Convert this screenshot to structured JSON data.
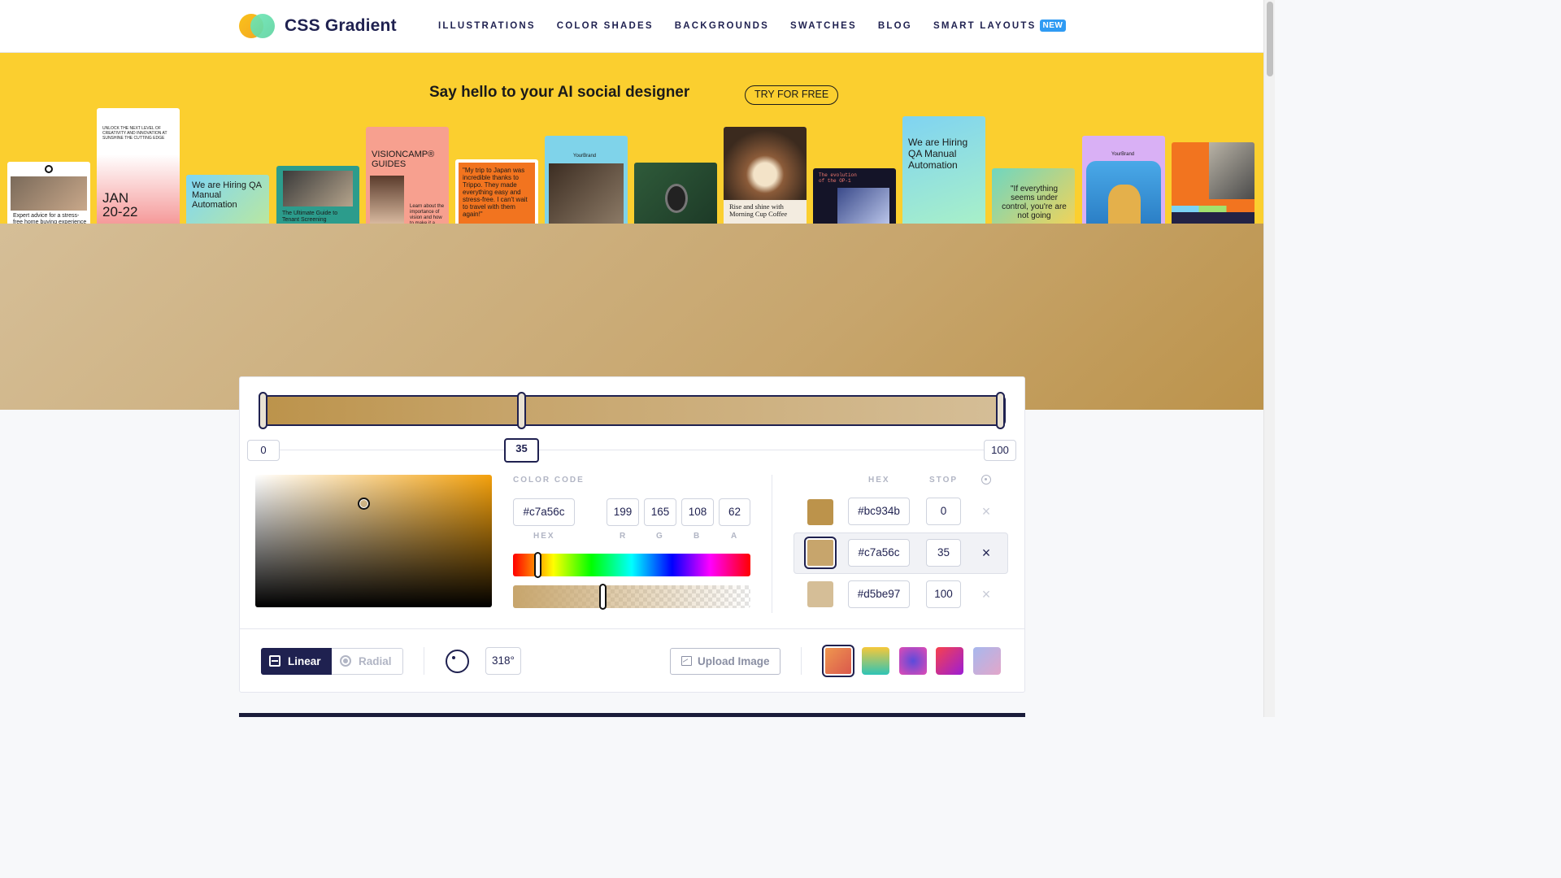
{
  "header": {
    "brand": "CSS Gradient",
    "nav": [
      {
        "label": "ILLUSTRATIONS"
      },
      {
        "label": "COLOR SHADES"
      },
      {
        "label": "BACKGROUNDS"
      },
      {
        "label": "SWATCHES"
      },
      {
        "label": "BLOG"
      },
      {
        "label": "SMART LAYOUTS",
        "badge": "NEW"
      }
    ]
  },
  "ad": {
    "title": "Say hello to your AI social designer",
    "cta": "TRY FOR FREE",
    "cards": [
      "Expert advice for a stress-free home buying experience",
      "UNLOCK THE NEXT LEVEL OF CREATIVITY AND INNOVATION AT SUNSHINE THE CUTTING EDGE",
      "JAN 20-22",
      "We are Hiring QA Manual Automation",
      "The Ultimate Guide to Tenant Screening",
      "VISIONCAMP® GUIDES",
      "Learn about the importance of vision and how to make it a",
      "\"My trip to Japan was incredible thanks to Trippo. They made everything easy and stress-free. I can't wait to travel with them again!\"",
      "YourBrand",
      "Rise and shine with Morning Cup Coffee",
      "The evolution of the OP-1",
      "We are Hiring QA Manual Automation",
      "\"If everything seems under control, you're are not going",
      "YourBrand"
    ]
  },
  "editor": {
    "gradient": {
      "type": "linear",
      "angle": 318,
      "stops": [
        {
          "hex": "#bc934b",
          "stop": 0
        },
        {
          "hex": "#c7a56c",
          "stop": 35
        },
        {
          "hex": "#d5be97",
          "stop": 100
        }
      ],
      "selected_stop_index": 1
    },
    "stop_pills": [
      "0",
      "35",
      "100"
    ],
    "color_code_label": "COLOR CODE",
    "hex_value": "#c7a56c",
    "r": "199",
    "g": "165",
    "b": "108",
    "a": "62",
    "labels": {
      "hex": "HEX",
      "r": "R",
      "g": "G",
      "b": "B",
      "a": "A"
    },
    "hue_position": 0.105,
    "alpha_position": 0.38,
    "stops_table": {
      "hex_header": "HEX",
      "stop_header": "STOP",
      "rows": [
        {
          "hex": "#bc934b",
          "stop": "0",
          "color": "#bc934b"
        },
        {
          "hex": "#c7a56c",
          "stop": "35",
          "color": "#c7a56c"
        },
        {
          "hex": "#d5be97",
          "stop": "100",
          "color": "#d5be97"
        }
      ]
    },
    "mode": {
      "linear": "Linear",
      "radial": "Radial"
    },
    "angle_label": "318°",
    "upload_label": "Upload Image",
    "presets": [
      "linear-gradient(135deg,#f09a4e,#d9544d)",
      "linear-gradient(180deg,#f6c83a,#2ec4b6)",
      "radial-gradient(circle,#5b4bdb,#e24bb4)",
      "linear-gradient(135deg,#f7414d,#9b1dd6)",
      "linear-gradient(135deg,#a7b8ee,#e3a6c9)"
    ]
  },
  "colors": {
    "navy": "#1f2150",
    "ad_yellow": "#fbcf2f",
    "badge_blue": "#2f9bf3"
  }
}
